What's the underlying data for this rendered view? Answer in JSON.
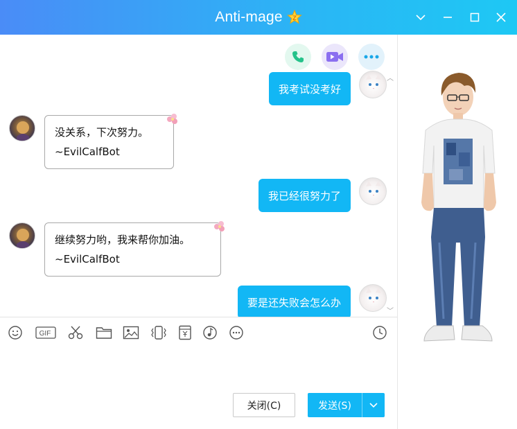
{
  "window": {
    "title": "Anti-mage",
    "vip_badge": "Z"
  },
  "chat": {
    "messages": [
      {
        "side": "right",
        "text": "我考试没考好"
      },
      {
        "side": "left",
        "lines": [
          "没关系，下次努力。",
          "~EvilCalfBot"
        ]
      },
      {
        "side": "right",
        "text": "我已经很努力了"
      },
      {
        "side": "left",
        "lines": [
          "继续努力哟，我来帮你加油。",
          "~EvilCalfBot"
        ]
      },
      {
        "side": "right",
        "text": "要是还失败会怎么办"
      }
    ]
  },
  "actions": {
    "close_label": "关闭(C)",
    "send_label": "发送(S)"
  },
  "toolbar": {
    "gif_label": "GIF"
  },
  "colors": {
    "accent": "#12b7f5",
    "titlebar_start": "#4a8cf7",
    "titlebar_end": "#1ec8f4"
  }
}
